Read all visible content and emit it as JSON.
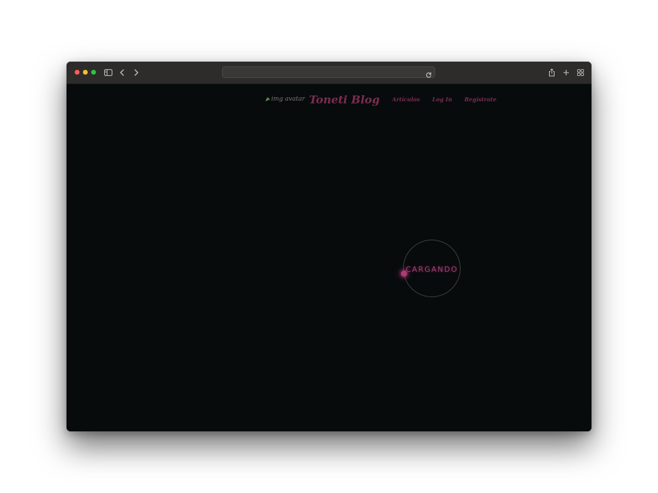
{
  "browser": {
    "address_value": "",
    "address_placeholder": "",
    "icons": {
      "sidebar": "sidebar-icon",
      "back": "chevron-left-icon",
      "forward": "chevron-right-icon",
      "reload": "reload-icon",
      "share": "share-icon",
      "new_tab": "plus-icon",
      "tab_overview": "tabs-grid-icon"
    },
    "traffic_light_colors": [
      "#fe5f57",
      "#febc2e",
      "#28c840"
    ]
  },
  "nav": {
    "avatar_alt": "img avatar",
    "brand": "Toneti Blog",
    "links": [
      "Artículos",
      "Log In",
      "Regístrate"
    ]
  },
  "loader": {
    "label": "CARGANDO"
  },
  "colors": {
    "background": "#070b0c",
    "accent": "#7a2d52",
    "loader_glow": "#b03a78"
  }
}
